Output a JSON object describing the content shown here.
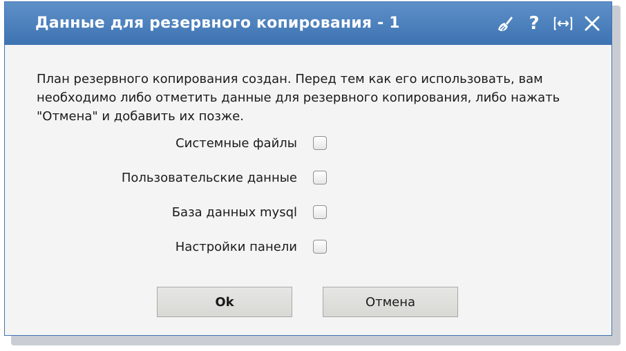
{
  "dialog": {
    "title": "Данные для резервного копирования - 1",
    "icons": [
      "broom-icon",
      "help-icon",
      "resize-icon",
      "close-icon"
    ],
    "help_glyph": "?",
    "message": "План резервного копирования создан. Перед тем как его использовать, вам необходимо либо отметить данные для резервного копирования, либо нажать \"Отмена\" и добавить их позже.",
    "options": [
      {
        "label": "Системные файлы",
        "checked": false
      },
      {
        "label": "Пользовательские данные",
        "checked": false
      },
      {
        "label": "База данных mysql",
        "checked": false
      },
      {
        "label": "Настройки панели",
        "checked": false
      }
    ],
    "buttons": {
      "ok_label": "Ok",
      "cancel_label": "Отмена"
    }
  },
  "colors": {
    "titlebar": "#4a80bf",
    "body": "#f4f4f4",
    "button": "#dcdcd8"
  }
}
